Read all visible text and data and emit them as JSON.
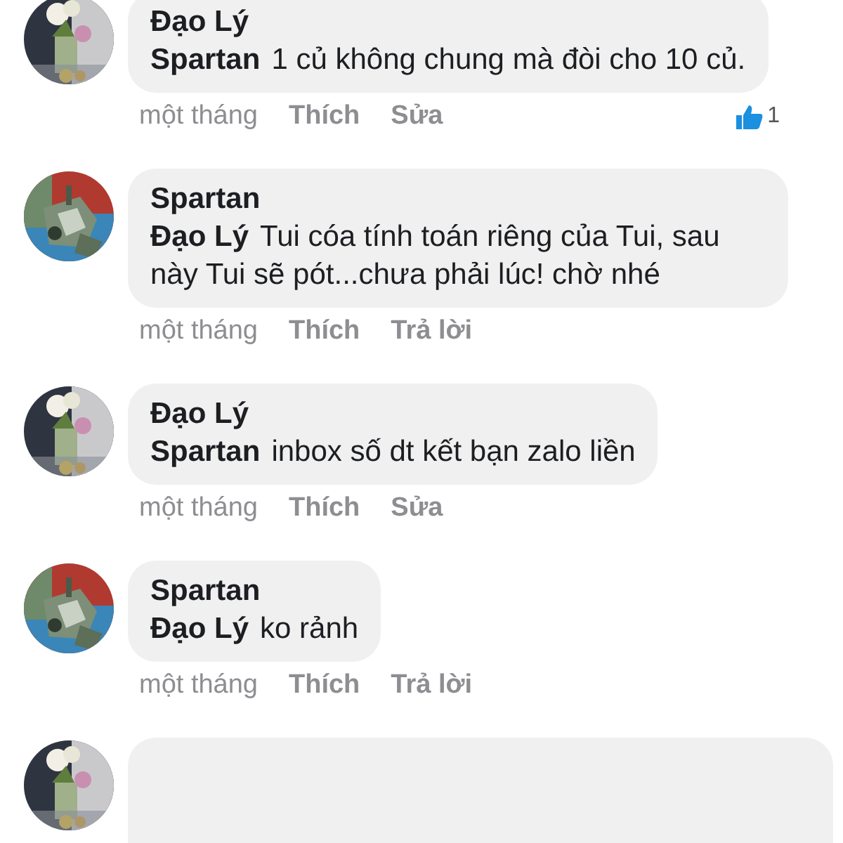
{
  "comments": [
    {
      "author": "Đạo Lý",
      "mention": "Spartan",
      "text": "1 củ không chung mà đòi cho 10 củ.",
      "time": "một tháng",
      "actions": [
        "Thích",
        "Sửa"
      ],
      "likes": "1"
    },
    {
      "author": "Spartan",
      "mention": "Đạo Lý",
      "text": "Tui cóa tính toán riêng của Tui, sau này Tui sẽ pót...chưa phải lúc! chờ nhé",
      "time": "một tháng",
      "actions": [
        "Thích",
        "Trả lời"
      ]
    },
    {
      "author": "Đạo Lý",
      "mention": "Spartan",
      "text": "inbox số dt kết bạn zalo liền",
      "time": "một tháng",
      "actions": [
        "Thích",
        "Sửa"
      ]
    },
    {
      "author": "Spartan",
      "mention": "Đạo Lý",
      "text": "ko rảnh",
      "time": "một tháng",
      "actions": [
        "Thích",
        "Trả lời"
      ]
    },
    {
      "kind": "partial"
    }
  ]
}
